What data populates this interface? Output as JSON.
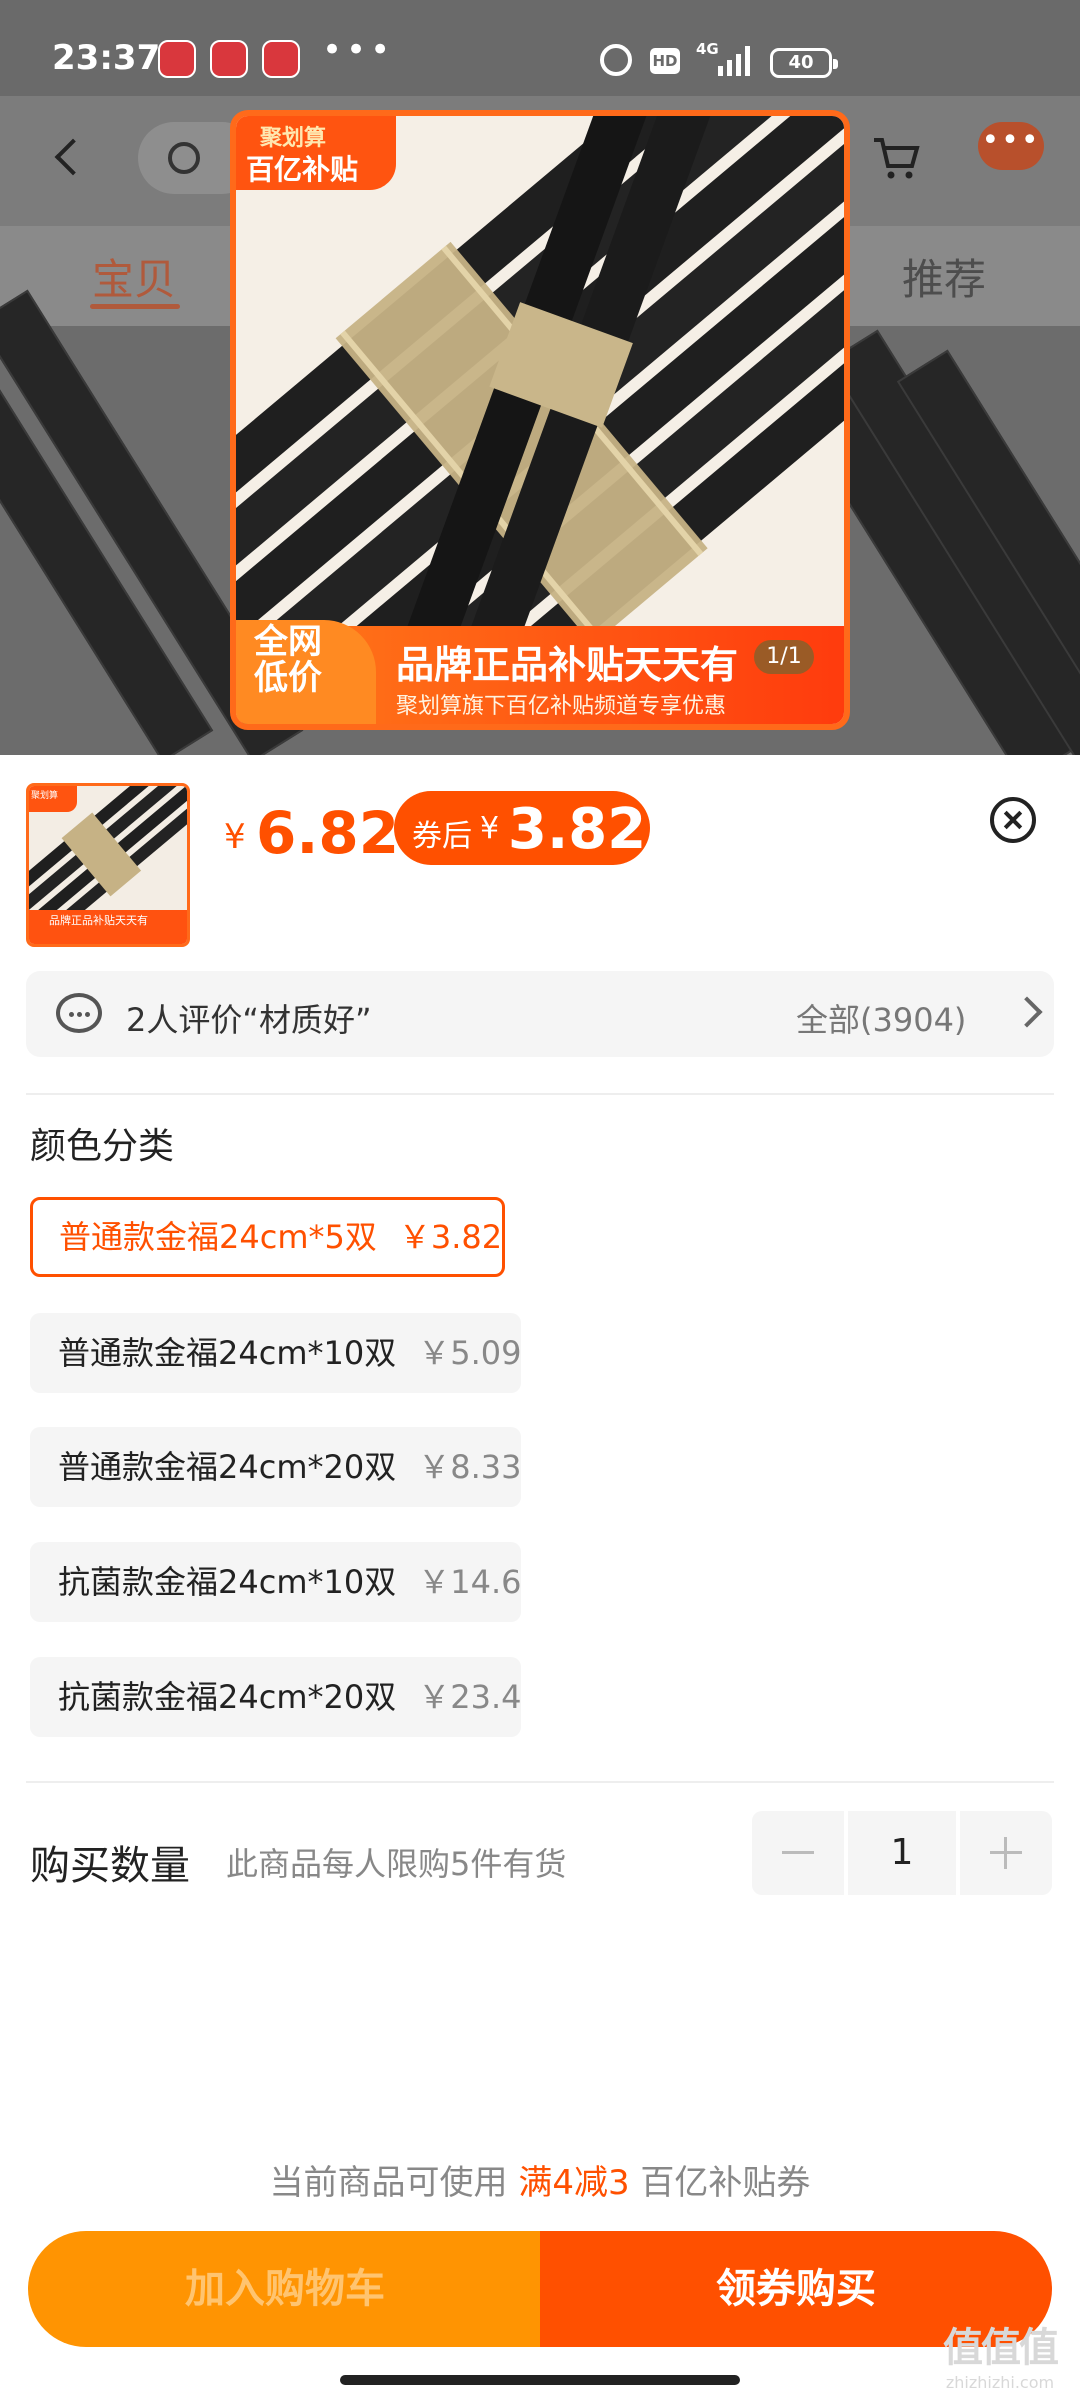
{
  "status_bar": {
    "time": "23:37",
    "dots": "•••",
    "hd": "HD",
    "network": "4G",
    "battery": "40"
  },
  "nav": {
    "tab_active": "宝贝",
    "tab_right": "推荐",
    "more": "•••"
  },
  "product_image": {
    "tag_top": "聚划算",
    "tag_main": "百亿补贴",
    "badge": "全网低价",
    "headline": "品牌正品补贴天天有",
    "subline": "聚划算旗下百亿补贴频道专享优惠",
    "counter": "1/1"
  },
  "thumbnail": {
    "banner": "品牌正品补贴天天有",
    "tag": "聚划算"
  },
  "price": {
    "currency": "¥",
    "value": "6.82",
    "coupon_label": "券后",
    "coupon_currency": "¥",
    "coupon_price": "3.82"
  },
  "reviews": {
    "text": "2人评价“材质好”",
    "all_label": "全部(3904)"
  },
  "color_section": {
    "title": "颜色分类",
    "options": [
      {
        "name": "普通款金福24cm*5双",
        "price": "￥3.82",
        "selected": true
      },
      {
        "name": "普通款金福24cm*10双",
        "price": "￥5.09",
        "selected": false
      },
      {
        "name": "普通款金福24cm*20双",
        "price": "￥8.33",
        "selected": false
      },
      {
        "name": "抗菌款金福24cm*10双",
        "price": "￥14.6",
        "selected": false
      },
      {
        "name": "抗菌款金福24cm*20双",
        "price": "￥23.4",
        "selected": false
      }
    ]
  },
  "quantity": {
    "label": "购买数量",
    "note": "此商品每人限购5件有货",
    "value": "1"
  },
  "coupon_note": {
    "prefix": "当前商品可使用 ",
    "highlight": "满4减3",
    "suffix": " 百亿补贴券"
  },
  "actions": {
    "add_to_cart": "加入购物车",
    "buy": "领券购买"
  },
  "watermark": {
    "logo": "值值值",
    "url": "zhizhizhi.com"
  },
  "colors": {
    "accent": "#ff5000",
    "cart_button": "#ff9402"
  }
}
